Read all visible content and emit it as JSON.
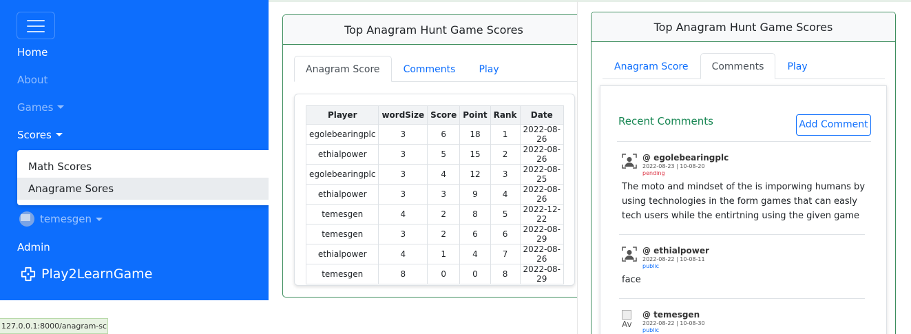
{
  "nav": {
    "home": "Home",
    "about": "About",
    "games": "Games",
    "scores": "Scores",
    "scores_menu": [
      "Math Scores",
      "Anagrame Sores"
    ],
    "user_avatar_alt": "A",
    "username": "temesgen",
    "admin": "Admin",
    "brand": "Play2LearnGame"
  },
  "status_url": "127.0.0.1:8000/anagram-sc...",
  "card1": {
    "title": "Top Anagram Hunt Game Scores",
    "tabs": [
      "Anagram Score",
      "Comments",
      "Play"
    ],
    "active_tab": "Anagram Score",
    "table": {
      "headers": [
        "Player",
        "wordSize",
        "Score",
        "Point",
        "Rank",
        "Date"
      ],
      "rows": [
        [
          "egolebearingplc",
          "3",
          "6",
          "18",
          "1",
          "2022-08-26"
        ],
        [
          "ethialpower",
          "3",
          "5",
          "15",
          "2",
          "2022-08-26"
        ],
        [
          "egolebearingplc",
          "3",
          "4",
          "12",
          "3",
          "2022-08-25"
        ],
        [
          "ethialpower",
          "3",
          "3",
          "9",
          "4",
          "2022-08-26"
        ],
        [
          "temesgen",
          "4",
          "2",
          "8",
          "5",
          "2022-12-22"
        ],
        [
          "temesgen",
          "3",
          "2",
          "6",
          "6",
          "2022-08-29"
        ],
        [
          "ethialpower",
          "4",
          "1",
          "4",
          "7",
          "2022-08-26"
        ],
        [
          "temesgen",
          "8",
          "0",
          "0",
          "8",
          "2022-08-29"
        ]
      ]
    }
  },
  "card2": {
    "title": "Top Anagram Hunt Game Scores",
    "tabs": [
      "Anagram Score",
      "Comments",
      "Play"
    ],
    "active_tab": "Comments",
    "recent_title": "Recent Comments",
    "add_button": "Add Comment",
    "comments": [
      {
        "user": "@ egolebearingplc",
        "date": "2022-08-23 | 10-08-20",
        "status": "pending",
        "status_color": "#dc3545",
        "text": [
          "The moto and mindset of the is imporwing humans by",
          "using technologies in the form games that can easly",
          "tech users while the entirtning using the given game"
        ]
      },
      {
        "user": "@ ethialpower",
        "date": "2022-08-22 | 10-08-11",
        "status": "public",
        "status_color": "#0d6efd",
        "text": [
          "face"
        ]
      },
      {
        "user": "@ temesgen",
        "date": "2022-08-22 | 10-08-30",
        "status": "public",
        "status_color": "#0d6efd",
        "avatar_alt": "Av"
      }
    ]
  },
  "colors": {
    "sidebar": "#0d6efd",
    "card_border": "#3e8e5e",
    "link": "#0d6efd",
    "success": "#198754"
  }
}
